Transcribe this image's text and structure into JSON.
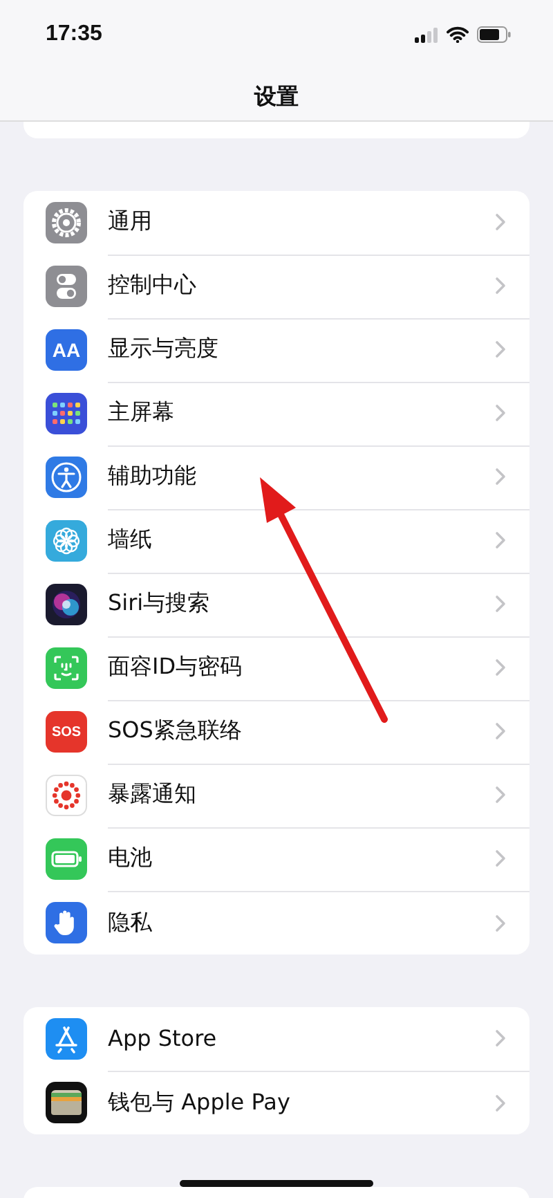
{
  "status_bar": {
    "time": "17:35"
  },
  "nav": {
    "title": "设置"
  },
  "groups": [
    {
      "items": [
        {
          "label": "通用",
          "kind": "gear"
        },
        {
          "label": "控制中心",
          "kind": "toggles"
        },
        {
          "label": "显示与亮度",
          "kind": "text-display",
          "icon_text": "AA"
        },
        {
          "label": "主屏幕",
          "kind": "grid"
        },
        {
          "label": "辅助功能",
          "kind": "accessibility"
        },
        {
          "label": "墙纸",
          "kind": "flower"
        },
        {
          "label": "Siri与搜索",
          "kind": "siri"
        },
        {
          "label": "面容ID与密码",
          "kind": "face"
        },
        {
          "label": "SOS紧急联络",
          "kind": "text-sos",
          "icon_text": "SOS"
        },
        {
          "label": "暴露通知",
          "kind": "exposure"
        },
        {
          "label": "电池",
          "kind": "battery"
        },
        {
          "label": "隐私",
          "kind": "hand"
        }
      ]
    },
    {
      "items": [
        {
          "label": "App Store",
          "kind": "appstore"
        },
        {
          "label": "钱包与 Apple Pay",
          "kind": "wallet"
        }
      ]
    }
  ]
}
